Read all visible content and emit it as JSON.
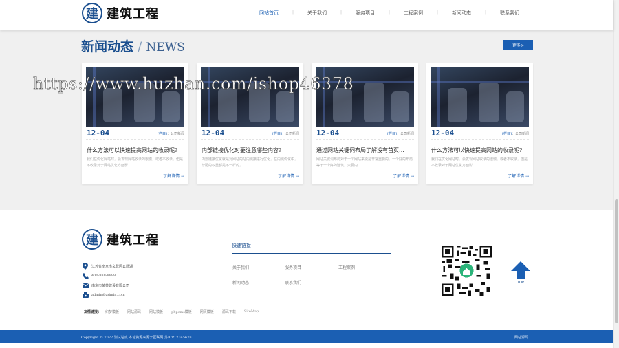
{
  "brand": {
    "badge": "建",
    "name": "建筑工程"
  },
  "nav": [
    {
      "label": "网站首页",
      "active": true
    },
    {
      "label": "关于我们"
    },
    {
      "label": "服务项目"
    },
    {
      "label": "工程案例"
    },
    {
      "label": "新闻动态"
    },
    {
      "label": "联系我们"
    }
  ],
  "news": {
    "title_cn": "新闻动态",
    "title_sep": "/",
    "title_en": "NEWS",
    "more_label": "更多>",
    "cards": [
      {
        "date": "12-04",
        "cat_tag": "[栏目]",
        "cat": "：公司新闻",
        "title": "什么方法可以快速提高网站的收录呢?",
        "excerpt": "我们在优化网站时，会发现网站收录的很慢，或者不收录，但是不收录对于网站优化方面影",
        "readmore": "了解详情 →"
      },
      {
        "date": "12-04",
        "cat_tag": "[栏目]",
        "cat": "：公司新闻",
        "title": "内部链接优化时要注意哪些内容?",
        "excerpt": "内部链接优化就是对网站的站内链接进行优化，在内链优化中，分配的权重都是不一样的，",
        "readmore": "了解详情 →"
      },
      {
        "date": "12-04",
        "cat_tag": "[栏目]",
        "cat": "：公司新闻",
        "title": "通过网站关键词布局了解没有首页…",
        "excerpt": "网站关键词布局对于一个网站来说是非常重要的，一个好的布局等于一个好的建筑，只要内",
        "readmore": "了解详情 →"
      },
      {
        "date": "12-04",
        "cat_tag": "[栏目]",
        "cat": "：公司新闻",
        "title": "什么方法可以快速提高网站的收录呢?",
        "excerpt": "我们在优化网站时，会发现网站收录的很慢，或者不收录，但是不收录对于网站优化方面影",
        "readmore": "了解详情 →"
      }
    ]
  },
  "watermark": "https://www.huzhan.com/ishop46378",
  "footer": {
    "contact": [
      {
        "icon": "location-icon",
        "text": "江苏省南京市玄武区玄武湖"
      },
      {
        "icon": "phone-icon",
        "text": "400-888-8888"
      },
      {
        "icon": "mail-icon",
        "text": "南京市某某建设有限公司"
      },
      {
        "icon": "fax-icon",
        "text": "admin@admin.com"
      }
    ],
    "links_title": "快速链接",
    "links": [
      "关于我们",
      "服务项目",
      "工程案例",
      "新闻动态",
      "联系我们"
    ],
    "top_label": "TOP",
    "friend_label": "友情链接：",
    "friend_links": [
      "织梦模板",
      "网站源码",
      "网站模板",
      "phpcms模板",
      "网页模板",
      "源码下载",
      "SiteMap"
    ],
    "copyright": "Copyright © 2022 测试站点 本站资源来源于互联网 苏ICP12345678",
    "bottom_link": "网站源码"
  },
  "colors": {
    "primary": "#1b5fb3",
    "dark_blue": "#1b4f8f",
    "section_bg": "#f0f0f0"
  }
}
